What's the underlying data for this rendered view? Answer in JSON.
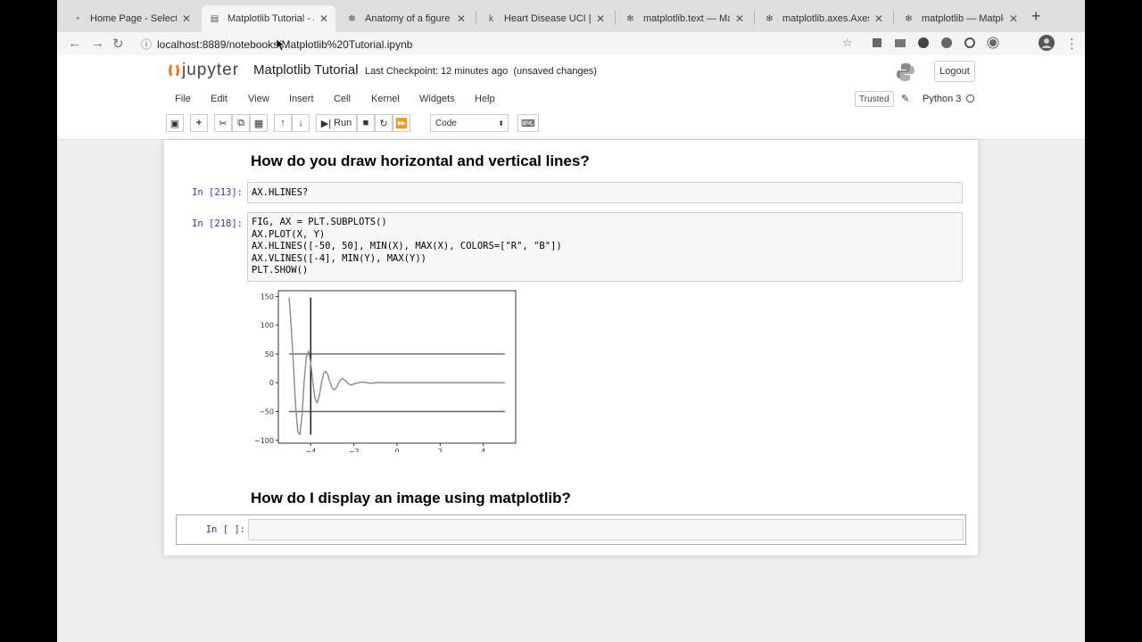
{
  "browser": {
    "tabs": [
      {
        "title": "Home Page - Select or",
        "active": false,
        "favicon": "jupyter-icon"
      },
      {
        "title": "Matplotlib Tutorial - Ju",
        "active": true,
        "favicon": "doc-icon"
      },
      {
        "title": "Anatomy of a figure —",
        "active": false,
        "favicon": "matplotlib-icon"
      },
      {
        "title": "Heart Disease UCI | Ka",
        "active": false,
        "favicon": "kaggle-icon"
      },
      {
        "title": "matplotlib.text — Matr",
        "active": false,
        "favicon": "matplotlib-icon"
      },
      {
        "title": "matplotlib.axes.Axes.t",
        "active": false,
        "favicon": "matplotlib-icon"
      },
      {
        "title": "matplotlib — Matplotlib",
        "active": false,
        "favicon": "matplotlib-icon"
      }
    ],
    "url": "localhost:8889/notebooks/Matplotlib%20Tutorial.ipynb"
  },
  "jupyter": {
    "logo_text": "jupyter",
    "notebook_title": "Matplotlib Tutorial",
    "checkpoint": "Last Checkpoint: 12 minutes ago",
    "unsaved": "(unsaved changes)",
    "logout": "Logout",
    "menu": [
      "File",
      "Edit",
      "View",
      "Insert",
      "Cell",
      "Kernel",
      "Widgets",
      "Help"
    ],
    "trusted": "Trusted",
    "kernel": "Python 3",
    "toolbar": {
      "run_label": "Run",
      "cell_type": "Code"
    }
  },
  "cells": {
    "heading1": "How do you draw horizontal and vertical lines?",
    "cell1_prompt": "In [213]:",
    "cell1_code": "AX.HLINES?",
    "cell2_prompt": "In [218]:",
    "cell2_lines": [
      "FIG, AX = PLT.SUBPLOTS()",
      "AX.PLOT(X, Y)",
      "AX.HLINES([-50, 50], MIN(X), MAX(X), COLORS=[\"R\", \"B\"])",
      "AX.VLINES([-4], MIN(Y), MAX(Y))",
      "PLT.SHOW()"
    ],
    "heading2": "How do I display an image using matplotlib?",
    "cell3_prompt": "In [ ]:",
    "cell3_code": ""
  },
  "chart_data": {
    "type": "line",
    "title": "",
    "xlabel": "",
    "ylabel": "",
    "xlim": [
      -5.5,
      5.5
    ],
    "ylim": [
      -105,
      160
    ],
    "xticks": [
      -4,
      -2,
      0,
      2,
      4
    ],
    "yticks": [
      -100,
      -50,
      0,
      50,
      100,
      150
    ],
    "series": [
      {
        "style": "damped-oscillation",
        "x": [
          -5.0,
          -4.9,
          -4.8,
          -4.7,
          -4.6,
          -4.5,
          -4.4,
          -4.3,
          -4.2,
          -4.1,
          -4.0,
          -3.9,
          -3.8,
          -3.7,
          -3.6,
          -3.5,
          -3.4,
          -3.3,
          -3.2,
          -3.1,
          -3.0,
          -2.9,
          -2.8,
          -2.7,
          -2.6,
          -2.5,
          -2.4,
          -2.3,
          -2.2,
          -2.1,
          -2.0,
          -1.8,
          -1.6,
          -1.4,
          -1.2,
          -1.0,
          -0.8,
          -0.6,
          -0.4,
          -0.2,
          0.0,
          1.0,
          2.0,
          3.0,
          4.0,
          5.0
        ],
        "y": [
          148,
          96,
          30,
          -40,
          -85,
          -90,
          -55,
          5,
          45,
          55,
          35,
          0,
          -28,
          -35,
          -22,
          0,
          16,
          20,
          13,
          0,
          -10,
          -12,
          -8,
          0,
          6,
          7,
          4,
          0,
          -3,
          -4,
          -2,
          0,
          1.5,
          0,
          -0.8,
          0,
          0.4,
          0,
          0,
          0,
          0,
          0,
          0,
          0,
          0,
          0
        ]
      }
    ],
    "hlines": {
      "y": [
        -50,
        50
      ],
      "xmin": -5,
      "xmax": 5
    },
    "vlines": {
      "x": [
        -4
      ],
      "ymin": -90,
      "ymax": 148
    }
  }
}
